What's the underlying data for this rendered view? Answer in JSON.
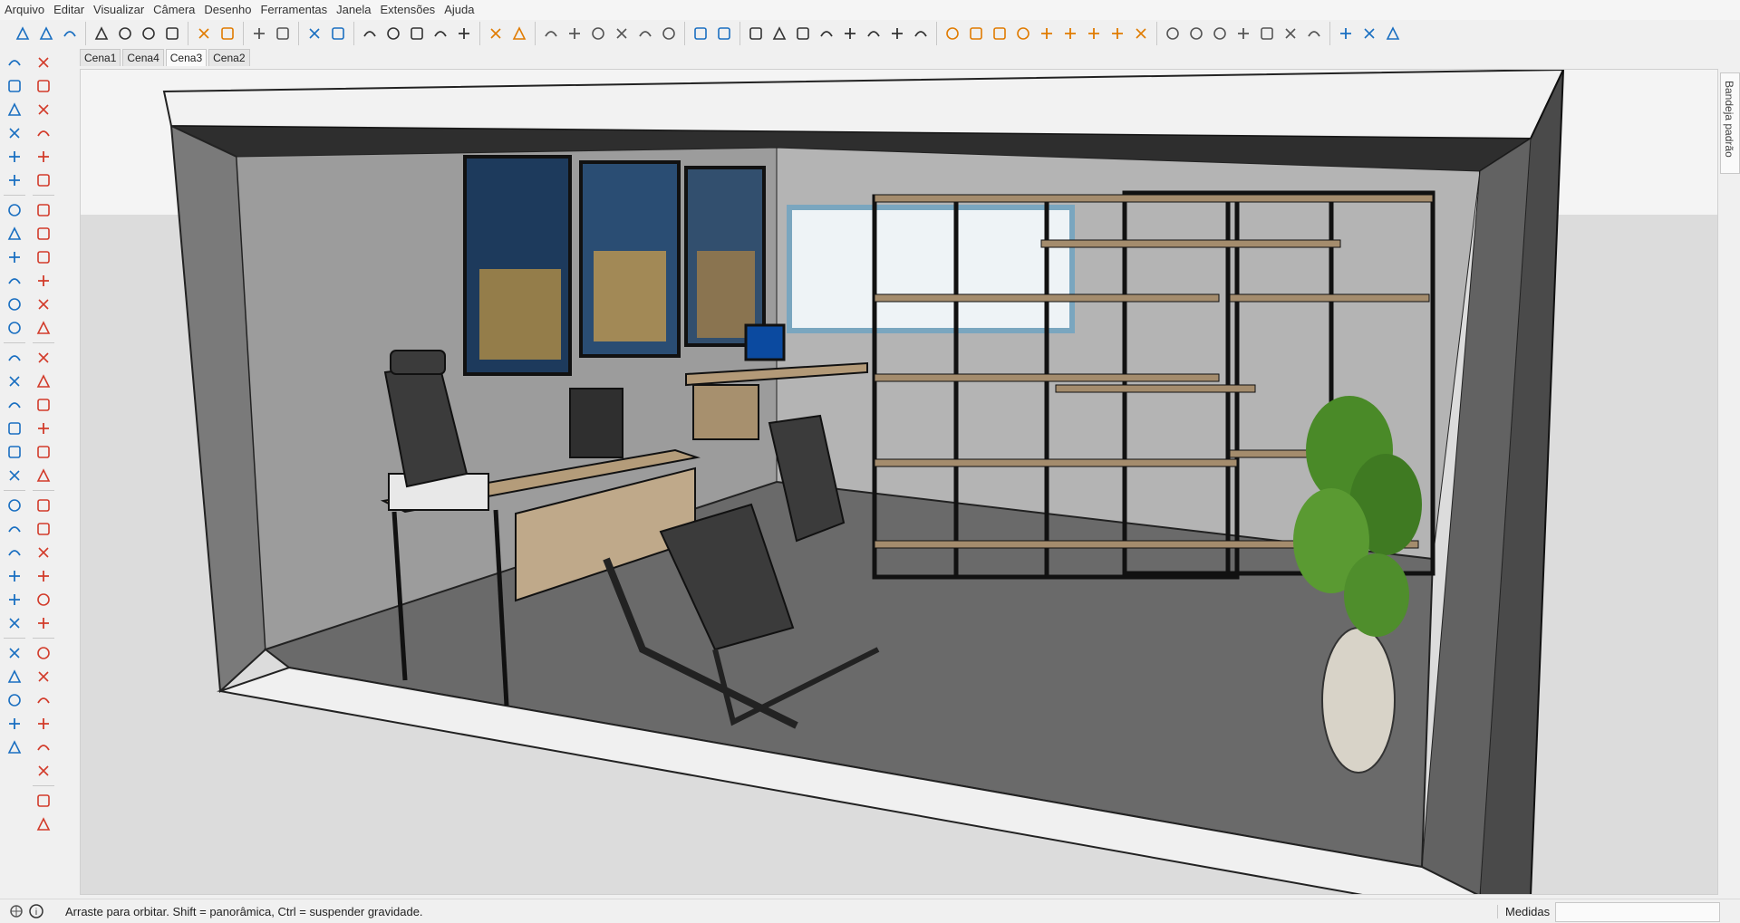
{
  "menu": [
    "Arquivo",
    "Editar",
    "Visualizar",
    "Câmera",
    "Desenho",
    "Ferramentas",
    "Janela",
    "Extensões",
    "Ajuda"
  ],
  "tabs": [
    {
      "label": "Cena1",
      "active": false
    },
    {
      "label": "Cena4",
      "active": false
    },
    {
      "label": "Cena3",
      "active": true
    },
    {
      "label": "Cena2",
      "active": false
    }
  ],
  "tray": {
    "label": "Bandeja padrão"
  },
  "status": {
    "message": "Arraste para orbitar. Shift = panorâmica, Ctrl = suspender gravidade.",
    "measure_label": "Medidas",
    "measure_value": ""
  },
  "colors": {
    "accent_blue": "#1a6fc1",
    "accent_orange": "#e07b00",
    "tool_red": "#d23b2a",
    "tool_green": "#2a9d2a"
  },
  "toolbar_icons": [
    [
      "new-icon",
      "open-icon",
      "save-icon"
    ],
    [
      "cut-icon",
      "copy-icon",
      "paste-icon",
      "erase-icon"
    ],
    [
      "undo-icon",
      "redo-icon"
    ],
    [
      "print-icon",
      "model-info-icon"
    ],
    [
      "sandbox-from-contours-icon",
      "sandbox-scratch-icon"
    ],
    [
      "smoove-icon",
      "stamp-icon",
      "drape-icon",
      "add-detail-icon",
      "flip-edge-icon"
    ],
    [
      "section-plane-icon",
      "section-cut-icon"
    ],
    [
      "iso-view-icon",
      "top-view-icon",
      "front-view-icon",
      "right-view-icon",
      "back-view-icon",
      "left-view-icon"
    ],
    [
      "components-icon",
      "materials-icon"
    ],
    [
      "xray-icon",
      "back-edges-icon",
      "wireframe-icon",
      "hidden-line-icon",
      "shaded-icon",
      "textured-icon",
      "monochrome-icon",
      "pointer-icon"
    ],
    [
      "tape-measure-icon",
      "dimension-icon",
      "protractor-icon",
      "text-icon",
      "axes-icon",
      "3d-text-icon",
      "style-icon",
      "shadows-icon",
      "fog-icon"
    ],
    [
      "warehouse-icon",
      "extension-icon",
      "share-model-icon",
      "upload-icon",
      "layout-icon",
      "preview-icon",
      "sandbox-icon"
    ],
    [
      "solid-union-icon",
      "solid-subtract-icon",
      "solid-trim-icon"
    ]
  ],
  "left_icons": {
    "col1": [
      "walk-icon",
      "orbit-icon",
      "ruler-icon",
      "tape-icon",
      "rotate-icon",
      "follow-icon",
      "cube-icon",
      "layers-add-icon",
      "layers-remove-icon",
      "move-icon",
      "orient-icon",
      "section-icon",
      "section-fill-icon",
      "fillet-icon",
      "cloud-icon",
      "clip-icon",
      "dollar-icon",
      "report-icon",
      "warehouse-icon",
      "solid-icon",
      "home-icon",
      "house-outline-icon",
      "component-icon",
      "scene-icon",
      "export-icon",
      "render-icon",
      "undo-step-icon",
      "document-icon",
      "go-icon"
    ],
    "col2": [
      "select-icon",
      "component-edit-icon",
      "line-icon",
      "freehand-icon",
      "rectangle-icon",
      "rotated-rect-icon",
      "circle-icon",
      "polygon-icon",
      "arc-icon",
      "arc3-icon",
      "pie-icon",
      "push-pull-icon",
      "move-tool-icon",
      "rotate-tool-icon",
      "scale-icon",
      "offset-icon",
      "follow-me-icon",
      "paint-icon",
      "tape-measure-tool-icon",
      "text-tool-icon",
      "axes-tool-icon",
      "dimension-tool-icon",
      "orbit-tool-icon",
      "pan-icon",
      "zoom-icon",
      "zoom-window-icon",
      "zoom-extents-icon",
      "position-camera-icon",
      "look-around-icon",
      "walk-tool-icon",
      "sandbox-tool-icon",
      "section-tool-icon"
    ]
  }
}
